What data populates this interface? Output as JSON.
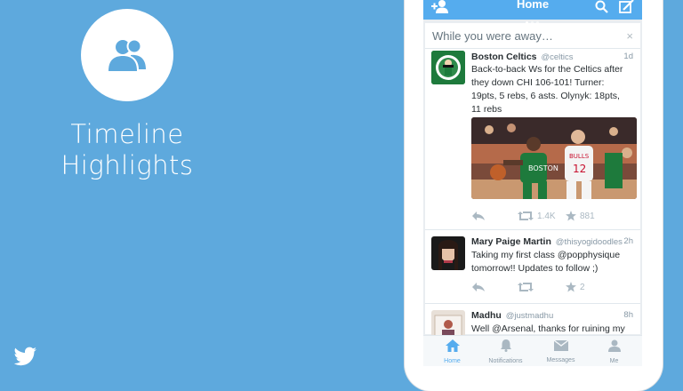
{
  "promo": {
    "title_line1": "Timeline",
    "title_line2": "Highlights",
    "icon": "people-icon",
    "logo": "twitter-bird-icon"
  },
  "app": {
    "header": {
      "title": "Home",
      "left_icon": "add-user-icon",
      "right_icons": [
        "search-icon",
        "compose-icon"
      ]
    },
    "away_section": {
      "title": "While you were away…",
      "close": "×"
    },
    "tweets": [
      {
        "name": "Boston Celtics",
        "handle": "@celtics",
        "time": "1d",
        "text_lines": [
          "Back-to-back Ws for the Celtics after",
          "they down CHI 106-101! Turner:",
          "19pts, 5 rebs, 6 asts. Olynyk: 18pts,",
          "11 rebs"
        ],
        "retweets": "1.4K",
        "favorites": "881"
      },
      {
        "name": "Mary Paige Martin",
        "handle": "@thisyogidoodles",
        "time": "2h",
        "text_lines": [
          "Taking my first class @popphysique",
          "tomorrow!! Updates to follow ;)"
        ],
        "retweets": "",
        "favorites": "2"
      },
      {
        "name": "Madhu",
        "handle": "@justmadhu",
        "time": "8h",
        "text_lines": [
          "Well @Arsenal, thanks for ruining my"
        ]
      }
    ],
    "tabs": [
      {
        "label": "Home",
        "icon": "home-icon"
      },
      {
        "label": "Notifications",
        "icon": "bell-icon"
      },
      {
        "label": "Messages",
        "icon": "envelope-icon"
      },
      {
        "label": "Me",
        "icon": "person-icon"
      }
    ]
  },
  "colors": {
    "background": "#5ea9dd",
    "accent": "#55acee",
    "celtics_green": "#1e7a3c",
    "bulls_red": "#c8102e"
  }
}
